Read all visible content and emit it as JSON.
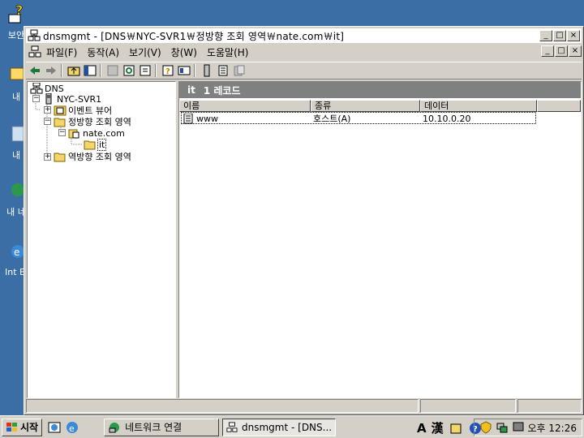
{
  "desktop": {
    "icons": [
      {
        "name": "help-icon",
        "label": "보안"
      },
      {
        "name": "my-computer-icon",
        "label": "내"
      },
      {
        "name": "recycle-icon",
        "label": "내 "
      },
      {
        "name": "network-places-icon",
        "label": "내 네"
      },
      {
        "name": "ie-icon",
        "label": "Int Ex"
      }
    ]
  },
  "window": {
    "title": "dnsmgmt - [DNS￦NYC-SVR1￦정방향 조회 영역￦nate.com￦it]",
    "caption_buttons": {
      "minimize": "_",
      "restore": "□",
      "close": "×"
    },
    "menu": [
      "파일(F)",
      "동작(A)",
      "보기(V)",
      "창(W)",
      "도움말(H)"
    ]
  },
  "tree": {
    "root": "DNS",
    "server": "NYC-SVR1",
    "event_viewer": "이벤트 뷰어",
    "forward_zones": "정방향 조회 영역",
    "zone": "nate.com",
    "subfolder": "it",
    "reverse_zones": "역방향 조회 영역"
  },
  "right": {
    "header_name": "it",
    "header_count": "1 레코드",
    "columns": [
      "이름",
      "종류",
      "데이터"
    ],
    "rows": [
      {
        "name": "www",
        "type": "호스트(A)",
        "data": "10.10.0.20"
      }
    ]
  },
  "taskbar": {
    "start_label": "시작",
    "tasks": [
      {
        "label": "네트워크 연결",
        "active": false
      },
      {
        "label": "dnsmgmt - [DNS...",
        "active": true
      }
    ],
    "ime": {
      "a": "A",
      "han": "漢"
    },
    "clock": "오후 12:26"
  },
  "colors": {
    "desktop": "#3a6ea5",
    "face": "#d4d0c8",
    "header": "#808080"
  }
}
